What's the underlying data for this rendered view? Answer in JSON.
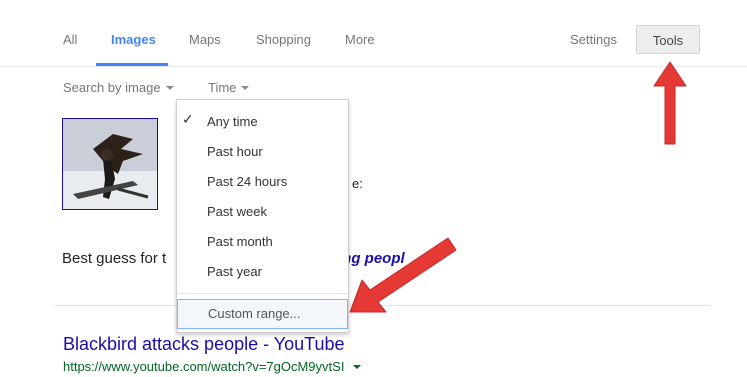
{
  "nav": {
    "tabs": [
      {
        "label": "All",
        "active": false
      },
      {
        "label": "Images",
        "active": true
      },
      {
        "label": "Maps",
        "active": false
      },
      {
        "label": "Shopping",
        "active": false
      },
      {
        "label": "More",
        "active": false
      }
    ],
    "settings_label": "Settings",
    "tools_label": "Tools"
  },
  "toolrow": {
    "search_by_image": "Search by image",
    "time": "Time"
  },
  "time_menu": {
    "selected": "Any time",
    "options": [
      "Any time",
      "Past hour",
      "Past 24 hours",
      "Past week",
      "Past month",
      "Past year"
    ],
    "custom_range": "Custom range..."
  },
  "partial_text": {
    "behind_menu": "e:",
    "best_guess_prefix": "Best guess for t",
    "best_guess_suffix": "ing peopl"
  },
  "result": {
    "title": "Blackbird attacks people - YouTube",
    "url": "https://www.youtube.com/watch?v=7gOcM9yvtSI"
  },
  "colors": {
    "accent": "#4285f4",
    "link": "#1a0dab",
    "url": "#006621",
    "arrow": "#e53935"
  }
}
